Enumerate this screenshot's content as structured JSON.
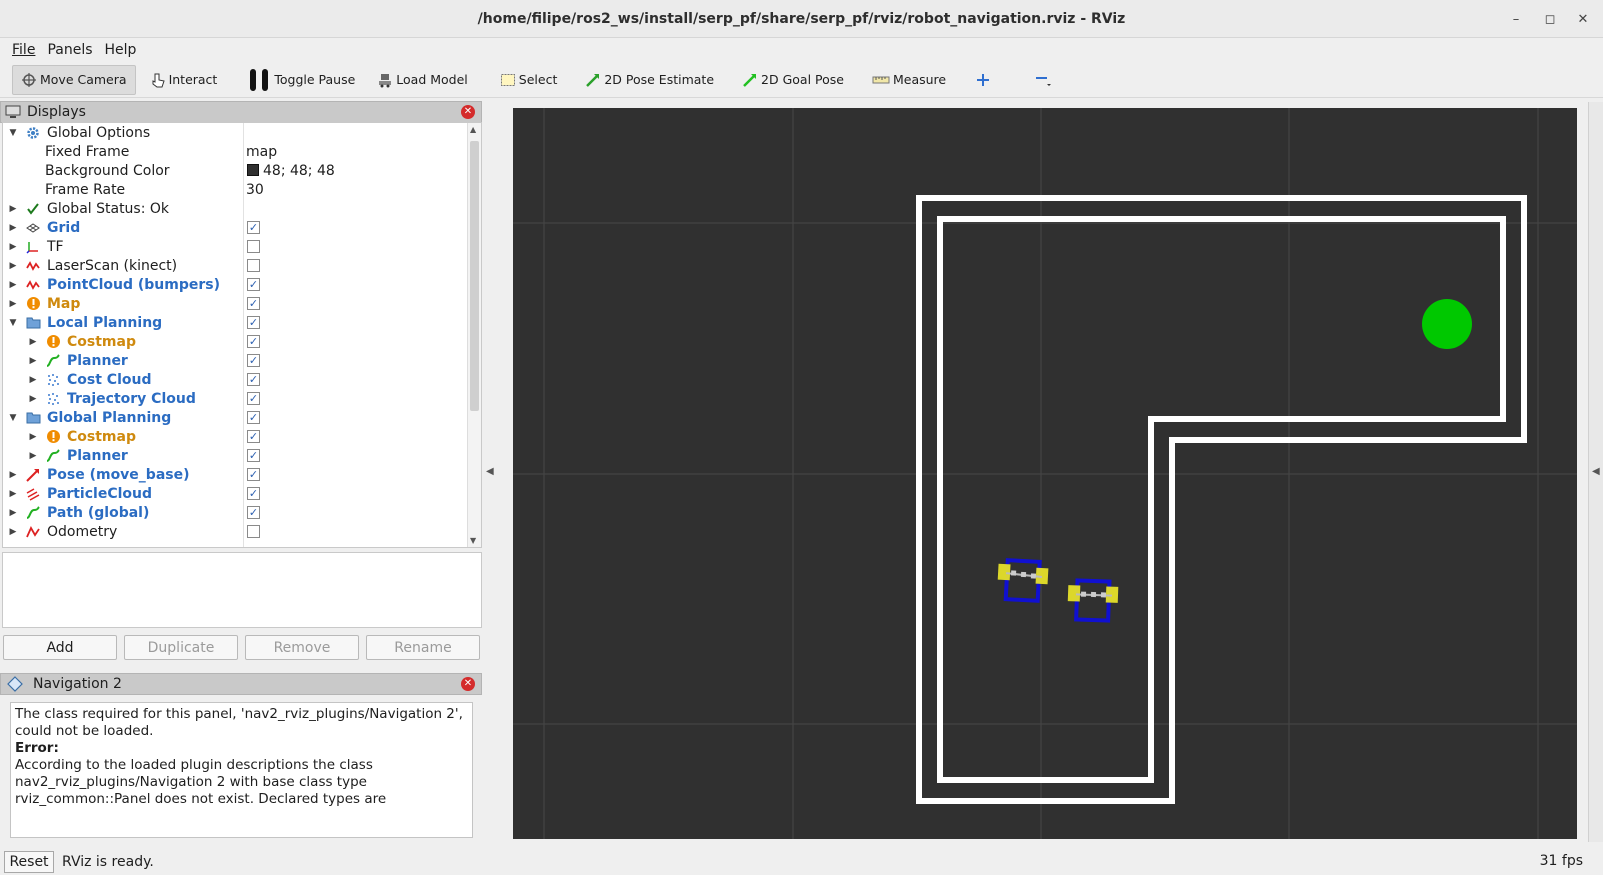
{
  "window": {
    "title": "/home/filipe/ros2_ws/install/serp_pf/share/serp_pf/rviz/robot_navigation.rviz - RViz"
  },
  "menu": {
    "file": "File",
    "panels": "Panels",
    "help": "Help"
  },
  "toolbar": {
    "move_camera": "Move Camera",
    "interact": "Interact",
    "toggle_pause": "Toggle Pause",
    "load_model": "Load Model",
    "select": "Select",
    "pose_estimate": "2D Pose Estimate",
    "goal_pose": "2D Goal Pose",
    "measure": "Measure"
  },
  "displays_panel": {
    "title": "Displays",
    "rows": [
      {
        "label": "Global Options"
      },
      {
        "label": "Fixed Frame",
        "value": "map"
      },
      {
        "label": "Background Color",
        "value": "48; 48; 48"
      },
      {
        "label": "Frame Rate",
        "value": "30"
      },
      {
        "label": "Global Status: Ok"
      },
      {
        "label": "Grid",
        "checked": true
      },
      {
        "label": "TF",
        "checked": false
      },
      {
        "label": "LaserScan (kinect)",
        "checked": false
      },
      {
        "label": "PointCloud (bumpers)",
        "checked": true
      },
      {
        "label": "Map",
        "checked": true
      },
      {
        "label": "Local Planning",
        "checked": true
      },
      {
        "label": "Costmap",
        "checked": true
      },
      {
        "label": "Planner",
        "checked": true
      },
      {
        "label": "Cost Cloud",
        "checked": true
      },
      {
        "label": "Trajectory Cloud",
        "checked": true
      },
      {
        "label": "Global Planning",
        "checked": true
      },
      {
        "label": "Costmap",
        "checked": true
      },
      {
        "label": "Planner",
        "checked": true
      },
      {
        "label": "Pose (move_base)",
        "checked": true
      },
      {
        "label": "ParticleCloud",
        "checked": true
      },
      {
        "label": "Path (global)",
        "checked": true
      },
      {
        "label": "Odometry",
        "checked": false
      }
    ],
    "buttons": {
      "add": "Add",
      "duplicate": "Duplicate",
      "remove": "Remove",
      "rename": "Rename"
    }
  },
  "navigation_panel": {
    "title": "Navigation 2",
    "message_1": "The class required for this panel, 'nav2_rviz_plugins/Navigation 2', could not be loaded.",
    "error_label": "Error:",
    "message_2": "According to the loaded plugin descriptions the class nav2_rviz_plugins/Navigation 2 with base class type rviz_common::Panel does not exist. Declared types are"
  },
  "status": {
    "reset": "Reset",
    "text": "RViz is ready.",
    "fps": "31 fps"
  },
  "colors": {
    "background": "#303030",
    "wall": "#ffffff",
    "goal": "#00c800",
    "robot": "#1010d0",
    "wheel": "#e6e02a"
  }
}
